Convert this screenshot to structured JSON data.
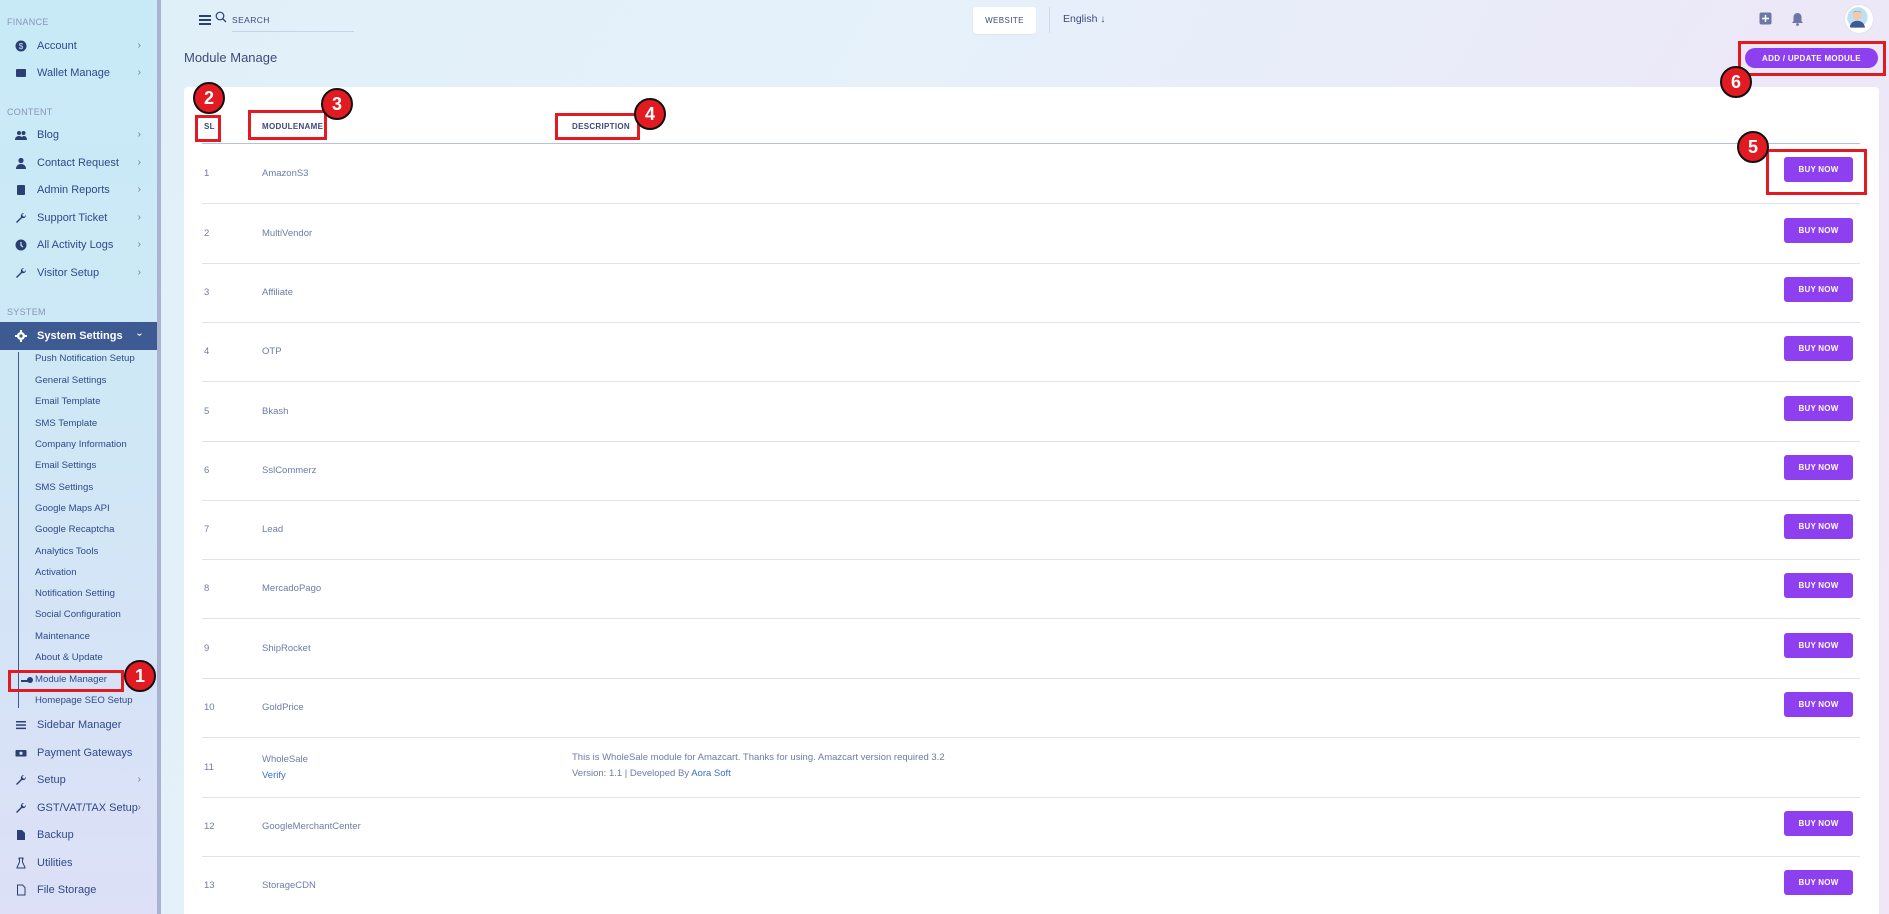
{
  "sidebar": {
    "sections": {
      "finance": "FINANCE",
      "content": "CONTENT",
      "system": "SYSTEM"
    },
    "finance_items": [
      {
        "label": "Account",
        "icon": "dollar-circle-icon"
      },
      {
        "label": "Wallet Manage",
        "icon": "wallet-icon"
      }
    ],
    "content_items": [
      {
        "label": "Blog",
        "icon": "users-icon"
      },
      {
        "label": "Contact Request",
        "icon": "user-icon"
      },
      {
        "label": "Admin Reports",
        "icon": "report-icon"
      },
      {
        "label": "Support Ticket",
        "icon": "wrench-icon"
      },
      {
        "label": "All Activity Logs",
        "icon": "clock-icon"
      },
      {
        "label": "Visitor Setup",
        "icon": "wrench-icon"
      }
    ],
    "system_settings": {
      "label": "System Settings",
      "sub_items": [
        "Push Notification Setup",
        "General Settings",
        "Email Template",
        "SMS Template",
        "Company Information",
        "Email Settings",
        "SMS Settings",
        "Google Maps API",
        "Google Recaptcha",
        "Analytics Tools",
        "Activation",
        "Notification Setting",
        "Social Configuration",
        "Maintenance",
        "About & Update",
        "Module Manager",
        "Homepage SEO Setup"
      ]
    },
    "bottom_items": [
      {
        "label": "Sidebar Manager",
        "icon": "list-icon"
      },
      {
        "label": "Payment Gateways",
        "icon": "money-icon"
      },
      {
        "label": "Setup",
        "icon": "wrench-icon"
      },
      {
        "label": "GST/VAT/TAX Setup",
        "icon": "wrench-icon"
      },
      {
        "label": "Backup",
        "icon": "file-icon"
      },
      {
        "label": "Utilities",
        "icon": "flask-icon"
      },
      {
        "label": "File Storage",
        "icon": "document-icon"
      }
    ]
  },
  "topbar": {
    "search_placeholder": "SEARCH",
    "website_label": "WEBSITE",
    "language": "English"
  },
  "page": {
    "title": "Module Manage",
    "add_button": "ADD / UPDATE MODULE"
  },
  "table": {
    "headers": {
      "sl": "SL",
      "name": "MODULENAME",
      "description": "DESCRIPTION"
    },
    "buy_label": "BUY NOW",
    "rows": [
      {
        "sl": "1",
        "name": "AmazonS3"
      },
      {
        "sl": "2",
        "name": "MultiVendor"
      },
      {
        "sl": "3",
        "name": "Affiliate"
      },
      {
        "sl": "4",
        "name": "OTP"
      },
      {
        "sl": "5",
        "name": "Bkash"
      },
      {
        "sl": "6",
        "name": "SslCommerz"
      },
      {
        "sl": "7",
        "name": "Lead"
      },
      {
        "sl": "8",
        "name": "MercadoPago"
      },
      {
        "sl": "9",
        "name": "ShipRocket"
      },
      {
        "sl": "10",
        "name": "GoldPrice"
      },
      {
        "sl": "11",
        "name": "WholeSale",
        "verify": "Verify",
        "description": "This is WholeSale module for Amazcart. Thanks for using. Amazcart version required 3.2",
        "version_prefix": "Version: 1.1 | Developed By",
        "developer": "Aora Soft"
      },
      {
        "sl": "12",
        "name": "GoogleMerchantCenter"
      },
      {
        "sl": "13",
        "name": "StorageCDN"
      }
    ]
  },
  "annotations": [
    "1",
    "2",
    "3",
    "4",
    "5",
    "6"
  ],
  "colors": {
    "accent": "#8e3ff0",
    "highlight": "#e21b23",
    "sidebar_active": "#3d5a93"
  }
}
